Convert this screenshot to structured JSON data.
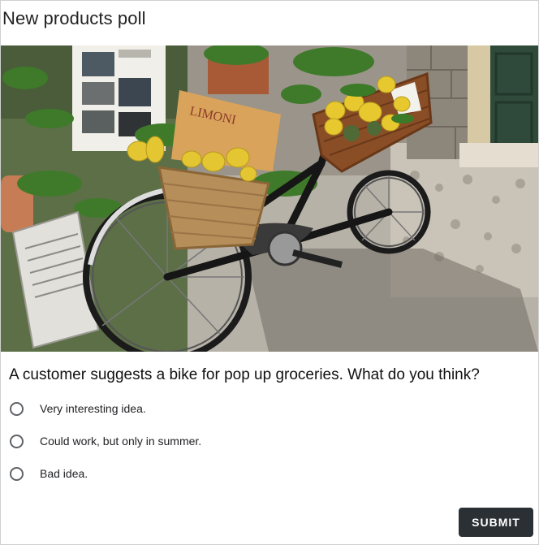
{
  "poll": {
    "title": "New products poll",
    "image": {
      "subject": "bicycle-with-lemon-baskets",
      "sign_text": "LIMONI"
    },
    "question": "A customer suggests a bike for pop up groceries. What do you think?",
    "options": [
      {
        "label": "Very interesting idea.",
        "selected": false
      },
      {
        "label": "Could work, but only in summer.",
        "selected": false
      },
      {
        "label": "Bad idea.",
        "selected": false
      }
    ],
    "submit_label": "SUBMIT"
  },
  "colors": {
    "submit_bg": "#2b3034",
    "radio_border": "#5f6368",
    "text": "#202124"
  }
}
